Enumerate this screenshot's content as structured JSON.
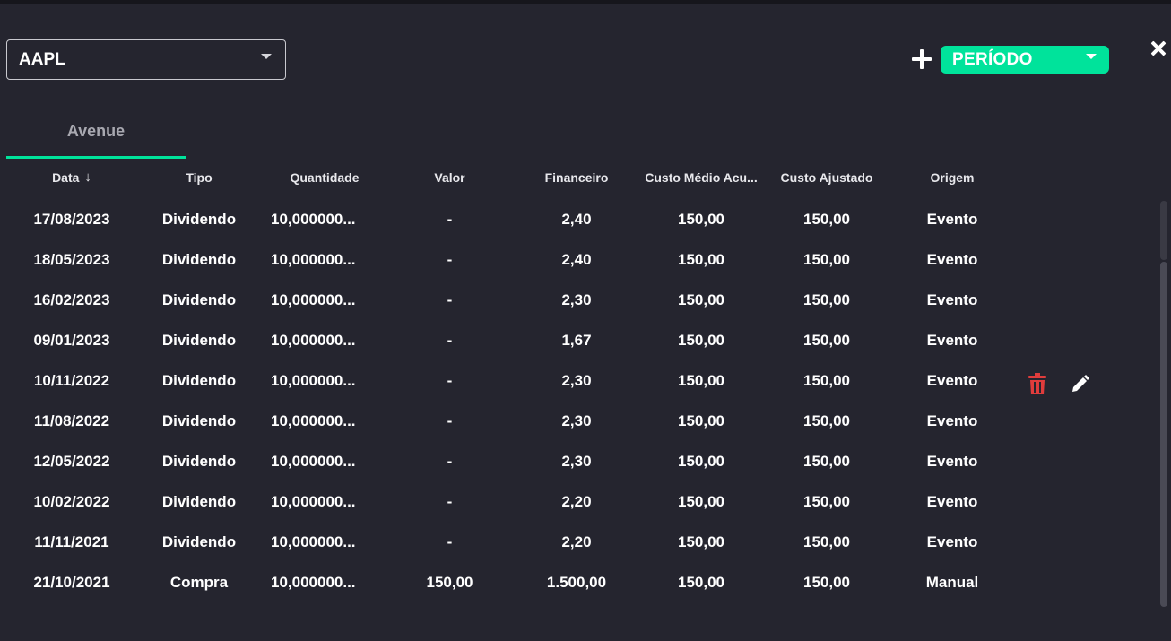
{
  "asset_select": {
    "value": "AAPL"
  },
  "period_button": {
    "label": "PERÍODO"
  },
  "tabs": [
    {
      "label": "Avenue",
      "active": true
    }
  ],
  "table": {
    "columns": [
      "Data",
      "Tipo",
      "Quantidade",
      "Valor",
      "Financeiro",
      "Custo Médio Acu...",
      "Custo Ajustado",
      "Origem"
    ],
    "sort": {
      "column": "Data",
      "direction": "desc",
      "icon": "arrow-down-icon"
    },
    "rows": [
      [
        "17/08/2023",
        "Dividendo",
        "10,000000...",
        "-",
        "2,40",
        "150,00",
        "150,00",
        "Evento"
      ],
      [
        "18/05/2023",
        "Dividendo",
        "10,000000...",
        "-",
        "2,40",
        "150,00",
        "150,00",
        "Evento"
      ],
      [
        "16/02/2023",
        "Dividendo",
        "10,000000...",
        "-",
        "2,30",
        "150,00",
        "150,00",
        "Evento"
      ],
      [
        "09/01/2023",
        "Dividendo",
        "10,000000...",
        "-",
        "1,67",
        "150,00",
        "150,00",
        "Evento"
      ],
      [
        "10/11/2022",
        "Dividendo",
        "10,000000...",
        "-",
        "2,30",
        "150,00",
        "150,00",
        "Evento"
      ],
      [
        "11/08/2022",
        "Dividendo",
        "10,000000...",
        "-",
        "2,30",
        "150,00",
        "150,00",
        "Evento"
      ],
      [
        "12/05/2022",
        "Dividendo",
        "10,000000...",
        "-",
        "2,30",
        "150,00",
        "150,00",
        "Evento"
      ],
      [
        "10/02/2022",
        "Dividendo",
        "10,000000...",
        "-",
        "2,20",
        "150,00",
        "150,00",
        "Evento"
      ],
      [
        "11/11/2021",
        "Dividendo",
        "10,000000...",
        "-",
        "2,20",
        "150,00",
        "150,00",
        "Evento"
      ],
      [
        "21/10/2021",
        "Compra",
        "10,000000...",
        "150,00",
        "1.500,00",
        "150,00",
        "150,00",
        "Manual"
      ]
    ],
    "row_actions": {
      "row": 9,
      "icons": [
        "trash-icon",
        "edit-icon"
      ]
    }
  },
  "colors": {
    "background": "#25252f",
    "accent": "#00e39b",
    "delete": "#e03c3c",
    "text": "#ffffff"
  }
}
